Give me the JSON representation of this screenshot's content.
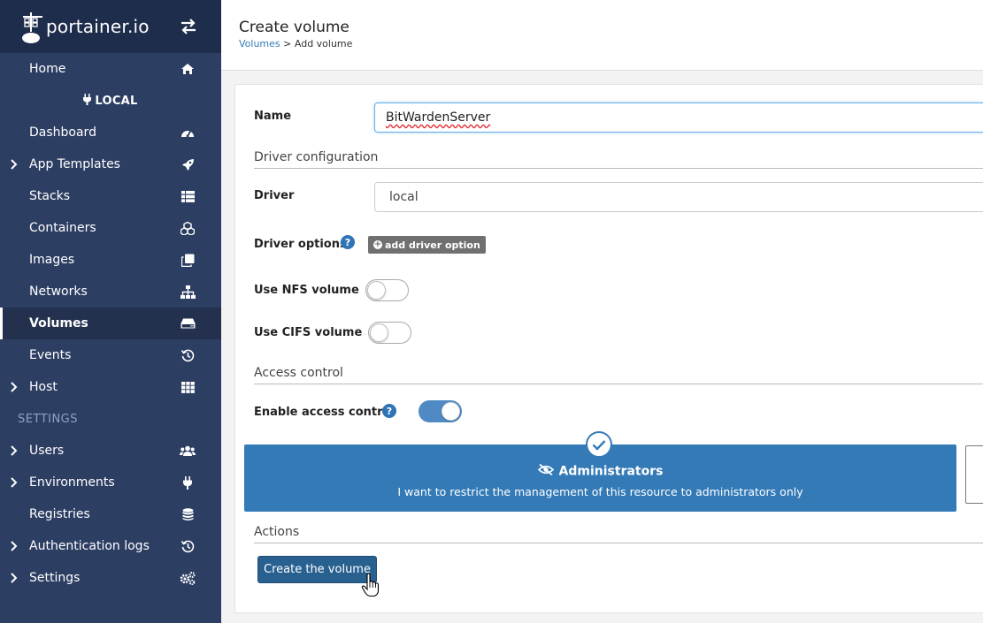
{
  "brand": {
    "name": "portainer.io"
  },
  "sidebar": {
    "items_top": [
      {
        "label": "Home",
        "icon": "home-icon"
      }
    ],
    "environment": "LOCAL",
    "items_env": [
      {
        "label": "Dashboard",
        "icon": "tachometer-icon",
        "expandable": false
      },
      {
        "label": "App Templates",
        "icon": "rocket-icon",
        "expandable": true
      },
      {
        "label": "Stacks",
        "icon": "th-list-icon",
        "expandable": false
      },
      {
        "label": "Containers",
        "icon": "cubes-icon",
        "expandable": false
      },
      {
        "label": "Images",
        "icon": "clone-icon",
        "expandable": false
      },
      {
        "label": "Networks",
        "icon": "sitemap-icon",
        "expandable": false
      },
      {
        "label": "Volumes",
        "icon": "hdd-icon",
        "expandable": false,
        "active": true
      },
      {
        "label": "Events",
        "icon": "history-icon",
        "expandable": false
      },
      {
        "label": "Host",
        "icon": "th-icon",
        "expandable": true
      }
    ],
    "settings_title": "SETTINGS",
    "items_settings": [
      {
        "label": "Users",
        "icon": "users-icon",
        "expandable": true
      },
      {
        "label": "Environments",
        "icon": "plug-icon",
        "expandable": true
      },
      {
        "label": "Registries",
        "icon": "database-icon",
        "expandable": false
      },
      {
        "label": "Authentication logs",
        "icon": "history-icon",
        "expandable": true
      },
      {
        "label": "Settings",
        "icon": "cogs-icon",
        "expandable": true
      }
    ]
  },
  "header": {
    "title": "Create volume",
    "breadcrumb_link": "Volumes",
    "breadcrumb_sep": " > ",
    "breadcrumb_current": "Add volume"
  },
  "form": {
    "name_label": "Name",
    "name_value": "BitWardenServer",
    "driver_section": "Driver configuration",
    "driver_label": "Driver",
    "driver_value": "local",
    "driver_options_label": "Driver options",
    "add_driver_option": "add driver option",
    "nfs_label": "Use NFS volume",
    "nfs_enabled": false,
    "cifs_label": "Use CIFS volume",
    "cifs_enabled": false,
    "access_section": "Access control",
    "access_label": "Enable access control",
    "access_enabled": true,
    "admin_title": "Administrators",
    "admin_desc": "I want to restrict the management of this resource to administrators only",
    "actions_section": "Actions",
    "create_button": "Create the volume"
  },
  "colors": {
    "sidebar_bg": "#2d3e63",
    "brand_bg": "#1f2d4c",
    "primary": "#337ab7",
    "button_primary": "#286090"
  }
}
